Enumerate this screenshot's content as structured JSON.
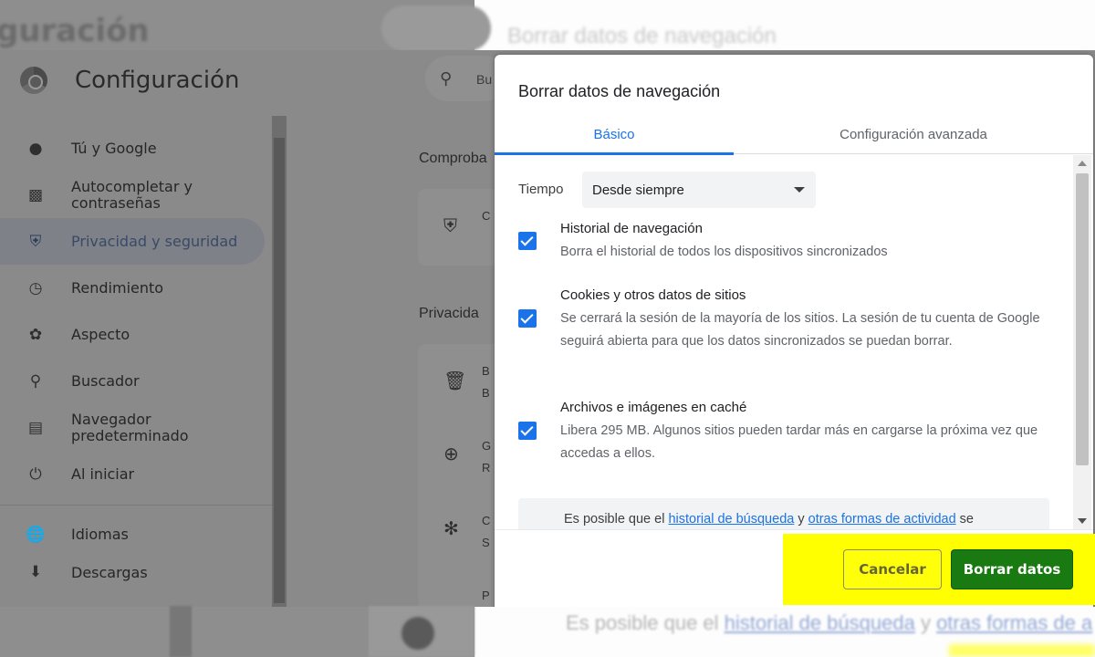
{
  "background": {
    "ghost_title": "guración",
    "ghost_dialog_title": "Borrar datos de navegación",
    "ghost_search_text": "Bu",
    "ghost_info_prefix": "Es posible que el ",
    "ghost_info_link1": "historial de búsqueda",
    "ghost_info_mid": " y ",
    "ghost_info_link2": "otras formas de a"
  },
  "settings": {
    "app_title": "Configuración",
    "search_text": "Bu",
    "sidebar": [
      {
        "label": "Tú y Google",
        "icon": "person-icon",
        "active": false
      },
      {
        "label": "Autocompletar y\ncontraseñas",
        "icon": "clipboard-icon",
        "active": false
      },
      {
        "label": "Privacidad y seguridad",
        "icon": "shield-icon",
        "active": true
      },
      {
        "label": "Rendimiento",
        "icon": "speedometer-icon",
        "active": false
      },
      {
        "label": "Aspecto",
        "icon": "palette-icon",
        "active": false
      },
      {
        "label": "Buscador",
        "icon": "search-icon",
        "active": false
      },
      {
        "label": "Navegador\npredeterminado",
        "icon": "browser-icon",
        "active": false
      },
      {
        "label": "Al iniciar",
        "icon": "power-icon",
        "active": false
      },
      {
        "label": "Idiomas",
        "icon": "globe-icon",
        "active": false
      },
      {
        "label": "Descargas",
        "icon": "download-icon",
        "active": false
      }
    ],
    "section_1": "Comproba",
    "section_2": "Privacida",
    "card_1_text": "C",
    "card_2_rows": [
      "B",
      "G",
      "C",
      "P"
    ],
    "card_2_subs": [
      "B",
      "R",
      "S",
      ""
    ]
  },
  "dialog": {
    "title": "Borrar datos de navegación",
    "tabs": {
      "basic": "Básico",
      "advanced": "Configuración avanzada"
    },
    "time_label": "Tiempo",
    "time_value": "Desde siempre",
    "options": [
      {
        "title": "Historial de navegación",
        "desc": "Borra el historial de todos los dispositivos sincronizados",
        "checked": true
      },
      {
        "title": "Cookies y otros datos de sitios",
        "desc": "Se cerrará la sesión de la mayoría de los sitios. La sesión de tu cuenta de Google seguirá abierta para que los datos sincronizados se puedan borrar.",
        "checked": true
      },
      {
        "title": "Archivos e imágenes en caché",
        "desc": "Libera 295 MB. Algunos sitios pueden tardar más en cargarse la próxima vez que accedas a ellos.",
        "checked": true
      }
    ],
    "info": {
      "prefix": "Es posible que el ",
      "link1": "historial de búsqueda",
      "mid": " y ",
      "link2": "otras formas de actividad",
      "suffix": " se"
    },
    "buttons": {
      "cancel": "Cancelar",
      "clear": "Borrar datos"
    }
  },
  "colors": {
    "accent_blue": "#1a73e8",
    "highlight_yellow": "#ffff00",
    "clear_button_green": "#1a7a12"
  }
}
